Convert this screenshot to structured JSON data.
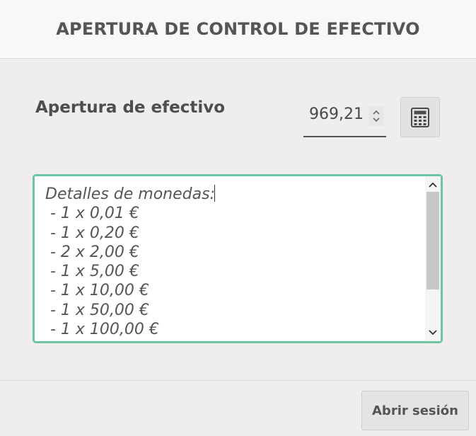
{
  "header": {
    "title": "APERTURA DE CONTROL DE EFECTIVO"
  },
  "form": {
    "opening_label": "Apertura de efectivo",
    "opening_amount": "969,21",
    "calculator_icon": "calculator-icon"
  },
  "details": {
    "title": "Detalles de monedas:",
    "lines": [
      " - 1 x 0,01 €",
      " - 1 x 0,20 €",
      " - 2 x 2,00 €",
      " - 1 x 5,00 €",
      " - 1 x 10,00 €",
      " - 1 x 50,00 €",
      " - 1 x 100,00 €"
    ]
  },
  "footer": {
    "open_session_label": "Abrir sesión"
  },
  "colors": {
    "focus_border": "#6ec49e",
    "background": "#efeded",
    "header_background": "#f8f8f8"
  }
}
